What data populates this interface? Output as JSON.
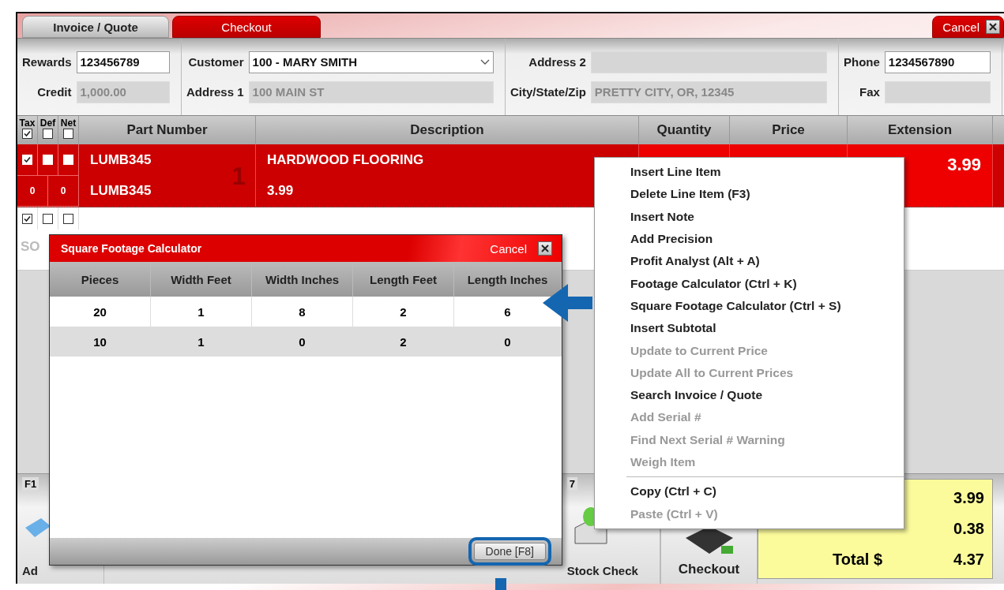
{
  "tabs": [
    {
      "label": "Invoice / Quote",
      "selected": true
    },
    {
      "label": "Checkout",
      "selected": false
    }
  ],
  "cancel_button": "Cancel",
  "header_groups": [
    {
      "fields": [
        {
          "label": "Rewards",
          "value": "123456789",
          "editable": true
        },
        {
          "label": "Credit",
          "value": "1,000.00",
          "editable": false
        }
      ]
    },
    {
      "fields": [
        {
          "label": "Customer",
          "value": "100 - MARY SMITH",
          "editable": true,
          "kind": "dropdown"
        },
        {
          "label": "Address 1",
          "value": "100 MAIN ST",
          "editable": false
        }
      ]
    },
    {
      "fields": [
        {
          "label": "Address 2",
          "editable": false
        },
        {
          "label": "City/State/Zip",
          "value": "PRETTY CITY, OR, 12345",
          "editable": false
        }
      ]
    },
    {
      "fields": [
        {
          "label": "Phone",
          "value": "1234567890",
          "editable": true
        },
        {
          "label": "Fax",
          "editable": false
        }
      ]
    }
  ],
  "grid": {
    "flag_columns": [
      {
        "label": "Tax",
        "checked": true
      },
      {
        "label": "Def",
        "checked": false
      },
      {
        "label": "Net",
        "checked": false
      }
    ],
    "columns": [
      "Part Number",
      "Description",
      "Quantity",
      "Price",
      "Extension"
    ],
    "rows": [
      {
        "selected": true,
        "flags": [
          true,
          false,
          false
        ],
        "counts": [
          "0",
          "0"
        ],
        "line_number": "1",
        "part_number": "LUMB345",
        "part_number_2": "LUMB345",
        "description": "HARDWOOD FLOORING",
        "description_2": "3.99",
        "extension": "3.99"
      },
      {
        "selected": false,
        "flags": [
          true,
          false,
          false
        ],
        "note": "SO"
      }
    ]
  },
  "function_keys": [
    {
      "key": "F1",
      "label": "Ad"
    },
    {
      "key": "7",
      "label": "Stock Check"
    }
  ],
  "checkout_button": "Checkout",
  "totals": [
    {
      "value": "3.99"
    },
    {
      "value": "0.38"
    },
    {
      "label": "Total $",
      "value": "4.37"
    }
  ],
  "dialog": {
    "title": "Square Footage Calculator",
    "cancel": "Cancel",
    "columns": [
      "Pieces",
      "Width Feet",
      "Width Inches",
      "Length Feet",
      "Length Inches"
    ],
    "rows": [
      [
        "20",
        "1",
        "8",
        "2",
        "6"
      ],
      [
        "10",
        "1",
        "0",
        "2",
        "0"
      ]
    ],
    "done_button": "Done [F8]"
  },
  "context_menu": [
    {
      "kind": "item",
      "label": "Insert Line Item",
      "disabled": false
    },
    {
      "kind": "item",
      "label": "Delete Line Item (F3)",
      "disabled": false
    },
    {
      "kind": "item",
      "label": "Insert Note",
      "disabled": false
    },
    {
      "kind": "item",
      "label": "Add Precision",
      "disabled": false
    },
    {
      "kind": "item",
      "label": "Profit Analyst (Alt + A)",
      "disabled": false
    },
    {
      "kind": "item",
      "label": "Footage Calculator (Ctrl + K)",
      "disabled": false
    },
    {
      "kind": "item",
      "label": "Square Footage Calculator (Ctrl + S)",
      "disabled": false
    },
    {
      "kind": "item",
      "label": "Insert Subtotal",
      "disabled": false
    },
    {
      "kind": "item",
      "label": "Update to Current Price",
      "disabled": true
    },
    {
      "kind": "item",
      "label": "Update All to Current Prices",
      "disabled": true
    },
    {
      "kind": "item",
      "label": "Search Invoice / Quote",
      "disabled": false
    },
    {
      "kind": "item",
      "label": "Add Serial #",
      "disabled": true
    },
    {
      "kind": "item",
      "label": "Find Next Serial # Warning",
      "disabled": true
    },
    {
      "kind": "item",
      "label": "Weigh Item",
      "disabled": true
    },
    {
      "kind": "separator"
    },
    {
      "kind": "item",
      "label": "Copy (Ctrl + C)",
      "disabled": false
    },
    {
      "kind": "item",
      "label": "Paste (Ctrl + V)",
      "disabled": true
    }
  ]
}
